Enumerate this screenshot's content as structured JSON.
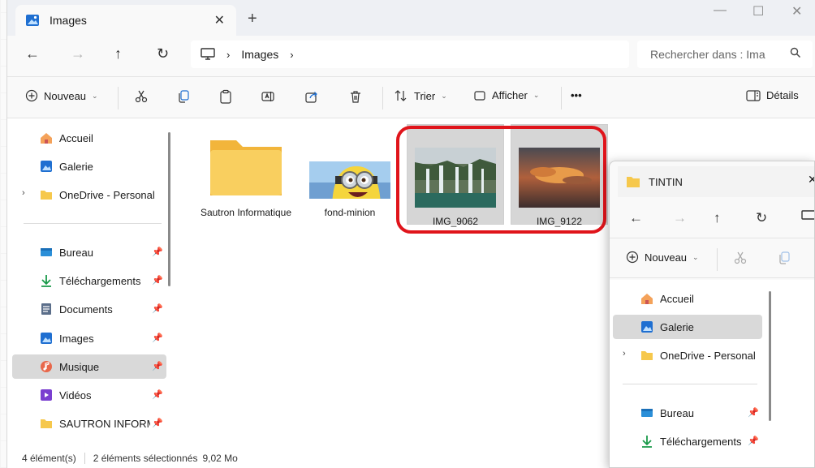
{
  "window": {
    "tab_title": "Images",
    "tab_close": "✕",
    "new_tab": "+",
    "minimize": "—",
    "maximize": "☐",
    "close": "✕"
  },
  "navigation": {
    "back": "←",
    "forward": "→",
    "up": "↑",
    "refresh": "↻",
    "breadcrumb": [
      "Images"
    ],
    "search_placeholder": "Rechercher dans : Ima"
  },
  "toolbar": {
    "new_label": "Nouveau",
    "sort_label": "Trier",
    "view_label": "Afficher",
    "more": "•••",
    "details_label": "Détails"
  },
  "sidebar": {
    "items": [
      {
        "label": "Accueil",
        "icon": "home-icon"
      },
      {
        "label": "Galerie",
        "icon": "gallery-icon"
      },
      {
        "label": "OneDrive - Personal",
        "icon": "folder-icon"
      },
      {
        "label": "Bureau",
        "icon": "desktop-icon"
      },
      {
        "label": "Téléchargements",
        "icon": "download-icon"
      },
      {
        "label": "Documents",
        "icon": "document-icon"
      },
      {
        "label": "Images",
        "icon": "images-icon"
      },
      {
        "label": "Musique",
        "icon": "music-icon"
      },
      {
        "label": "Vidéos",
        "icon": "videos-icon"
      },
      {
        "label": "SAUTRON INFORM",
        "icon": "folder-icon"
      }
    ],
    "selected": "Musique"
  },
  "files": [
    {
      "name": "Sautron Informatique",
      "type": "folder",
      "selected": false
    },
    {
      "name": "fond-minion",
      "type": "image",
      "selected": false
    },
    {
      "name": "IMG_9062",
      "type": "image",
      "selected": true
    },
    {
      "name": "IMG_9122",
      "type": "image",
      "selected": true
    }
  ],
  "status": {
    "count": "4 élément(s)",
    "selection": "2 éléments sélectionnés",
    "size": "9,02 Mo"
  },
  "second_window": {
    "tab_title": "TINTIN",
    "tab_close": "✕",
    "new_label": "Nouveau",
    "sidebar": [
      {
        "label": "Accueil"
      },
      {
        "label": "Galerie"
      },
      {
        "label": "OneDrive - Personal"
      },
      {
        "label": "Bureau"
      },
      {
        "label": "Téléchargements"
      }
    ],
    "selected": "Galerie"
  },
  "colors": {
    "selection_highlight": "#e0141b",
    "folder": "#f6c84c",
    "accent": "#0067c0"
  }
}
